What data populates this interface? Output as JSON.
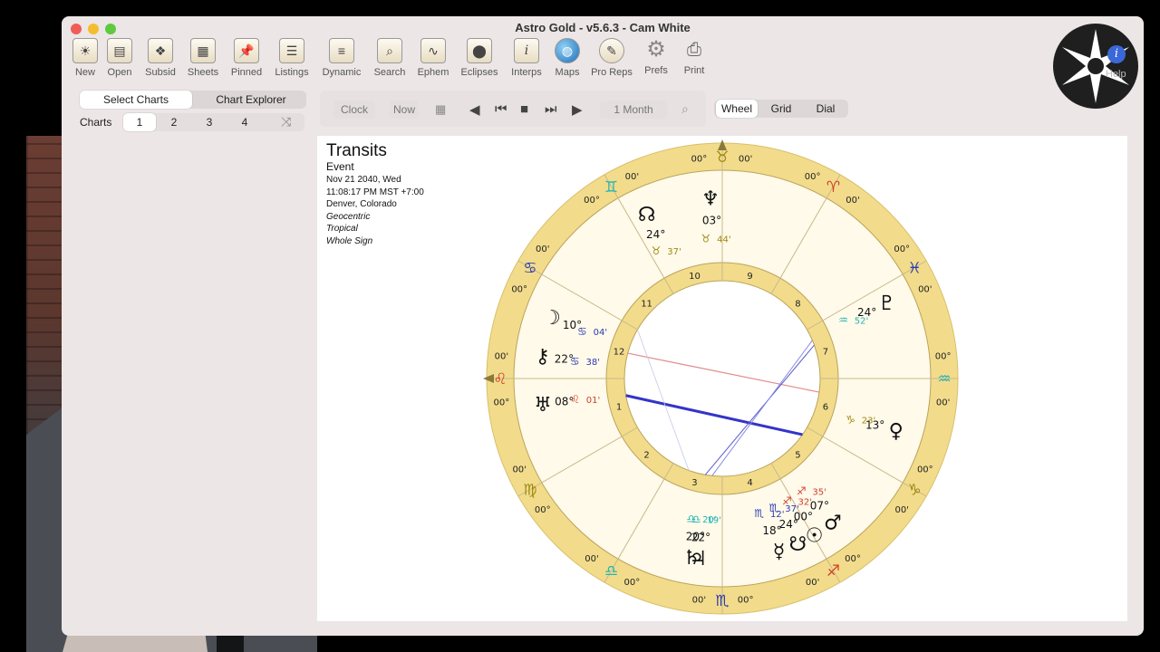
{
  "window": {
    "title": "Astro Gold - v5.6.3 - Cam White"
  },
  "toolbar": {
    "items": [
      {
        "label": "New",
        "icon": "new-chart-icon"
      },
      {
        "label": "Open",
        "icon": "open-folder-icon"
      },
      {
        "label": "Subsid",
        "icon": "subsid-icon"
      },
      {
        "label": "Sheets",
        "icon": "sheets-icon"
      },
      {
        "label": "Pinned",
        "icon": "pin-icon"
      },
      {
        "label": "Listings",
        "icon": "listings-icon"
      },
      {
        "label": "Dynamic",
        "icon": "dynamic-icon"
      },
      {
        "label": "Search",
        "icon": "search-icon"
      },
      {
        "label": "Ephem",
        "icon": "ephemeris-icon"
      },
      {
        "label": "Eclipses",
        "icon": "eclipses-icon"
      },
      {
        "label": "Interps",
        "icon": "info-icon"
      },
      {
        "label": "Maps",
        "icon": "globe-icon"
      },
      {
        "label": "Pro Reps",
        "icon": "quill-icon"
      },
      {
        "label": "Prefs",
        "icon": "gear-icon"
      },
      {
        "label": "Print",
        "icon": "printer-icon"
      }
    ],
    "help_label": "Help"
  },
  "select_tabs": {
    "select_charts": "Select Charts",
    "chart_explorer": "Chart Explorer"
  },
  "charts_row": {
    "label": "Charts",
    "numbers": [
      "1",
      "2",
      "3",
      "4"
    ],
    "selected": "1"
  },
  "time_controls": {
    "clock": "Clock",
    "now": "Now",
    "step": "1 Month"
  },
  "view_tabs": {
    "wheel": "Wheel",
    "grid": "Grid",
    "dial": "Dial",
    "selected": "Wheel"
  },
  "chart_info": {
    "title": "Transits",
    "type": "Event",
    "date": "Nov 21 2040, Wed",
    "time": "11:08:17 PM MST +7:00",
    "place": "Denver, Colorado",
    "zodiac_view": "Geocentric",
    "zodiac": "Tropical",
    "house_system": "Whole Sign"
  },
  "wheel": {
    "houses": [
      "1",
      "2",
      "3",
      "4",
      "5",
      "6",
      "7",
      "8",
      "9",
      "10",
      "11",
      "12"
    ],
    "cusp_labels": [
      {
        "deg": "00°",
        "min": "00'",
        "sign": "♌",
        "color": "#d0402a"
      },
      {
        "deg": "00°",
        "min": "00'",
        "sign": "♍",
        "color": "#a08a10"
      },
      {
        "deg": "00°",
        "min": "00'",
        "sign": "♎",
        "color": "#24b5b5"
      },
      {
        "deg": "00°",
        "min": "00'",
        "sign": "♏",
        "color": "#2a3ab0"
      },
      {
        "deg": "00°",
        "min": "00'",
        "sign": "♐",
        "color": "#d0402a"
      },
      {
        "deg": "00°",
        "min": "00'",
        "sign": "♑",
        "color": "#a08a10"
      },
      {
        "deg": "00°",
        "min": "00'",
        "sign": "♒",
        "color": "#24b5b5"
      },
      {
        "deg": "00°",
        "min": "00'",
        "sign": "♓",
        "color": "#2a3ab0"
      },
      {
        "deg": "00°",
        "min": "00'",
        "sign": "♈",
        "color": "#d0402a"
      },
      {
        "deg": "00°",
        "min": "00'",
        "sign": "♉",
        "color": "#a08a10"
      },
      {
        "deg": "00°",
        "min": "00'",
        "sign": "♊",
        "color": "#24b5b5"
      },
      {
        "deg": "00°",
        "min": "00'",
        "sign": "♋",
        "color": "#2a3ab0"
      }
    ],
    "planets": [
      {
        "name": "Neptune",
        "glyph": "♆",
        "deg": "03°",
        "sign": "♉",
        "min": "44'"
      },
      {
        "name": "North Node",
        "glyph": "☊",
        "deg": "24°",
        "sign": "♉",
        "min": "37'"
      },
      {
        "name": "Moon",
        "glyph": "☽",
        "deg": "10°",
        "sign": "♋",
        "min": "04'"
      },
      {
        "name": "Chiron",
        "glyph": "⚷",
        "deg": "22°",
        "sign": "♋",
        "min": "38'"
      },
      {
        "name": "Uranus",
        "glyph": "♅",
        "deg": "08°",
        "sign": "♌",
        "min": "01'"
      },
      {
        "name": "Pluto",
        "glyph": "♇",
        "deg": "24°",
        "sign": "♒",
        "min": "52'"
      },
      {
        "name": "Venus",
        "glyph": "♀",
        "deg": "13°",
        "sign": "♑",
        "min": "23'"
      },
      {
        "name": "Saturn",
        "glyph": "♄",
        "deg": "20°",
        "sign": "♎",
        "min": "20'"
      },
      {
        "name": "Jupiter",
        "glyph": "♃",
        "deg": "22°",
        "sign": "♎",
        "min": "19'"
      },
      {
        "name": "Mercury",
        "glyph": "☿",
        "deg": "18°",
        "sign": "♏",
        "min": "12'"
      },
      {
        "name": "South Node",
        "glyph": "☋",
        "deg": "24°",
        "sign": "♏",
        "min": "37'"
      },
      {
        "name": "Mars",
        "glyph": "♂",
        "deg": "07°",
        "sign": "♐",
        "min": "35'"
      },
      {
        "name": "Sun",
        "glyph": "☉",
        "deg": "00°",
        "sign": "♐",
        "min": "32'"
      }
    ]
  },
  "colors": {
    "fire": "#d0402a",
    "earth": "#a08a10",
    "air": "#24b5b5",
    "water": "#2a3ab0",
    "wheel_ring": "#f2dc8c",
    "wheel_bg": "#fffaea"
  }
}
